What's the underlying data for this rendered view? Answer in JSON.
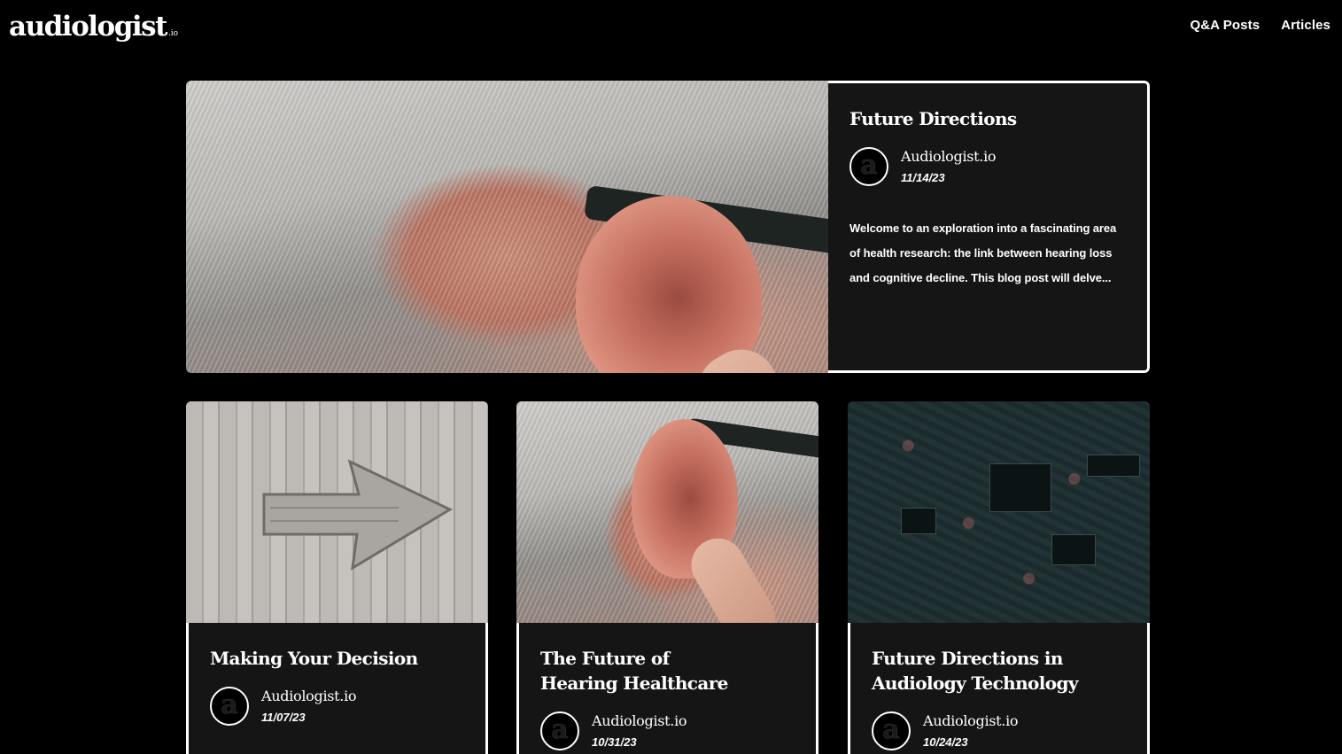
{
  "header": {
    "logo_main": "audiologist",
    "logo_tld": ".io",
    "nav": [
      {
        "label": "Q&A Posts"
      },
      {
        "label": "Articles"
      }
    ]
  },
  "featured": {
    "title": "Future Directions",
    "author_initial": "a",
    "author": "Audiologist.io",
    "date": "11/14/23",
    "excerpt": "Welcome to an exploration into a fascinating area of health research: the link between hearing loss and cognitive decline. This blog post will delve..."
  },
  "cards": [
    {
      "title_line1": "Making Your Decision",
      "title_line2": "",
      "author_initial": "a",
      "author": "Audiologist.io",
      "date": "11/07/23"
    },
    {
      "title_line1": "The Future of",
      "title_line2": "Hearing Healthcare",
      "author_initial": "a",
      "author": "Audiologist.io",
      "date": "10/31/23"
    },
    {
      "title_line1": "Future Directions in",
      "title_line2": "Audiology Technology",
      "author_initial": "a",
      "author": "Audiologist.io",
      "date": "10/24/23"
    }
  ],
  "colors": {
    "background": "#000000",
    "panel": "#151515",
    "text": "#ffffff"
  }
}
